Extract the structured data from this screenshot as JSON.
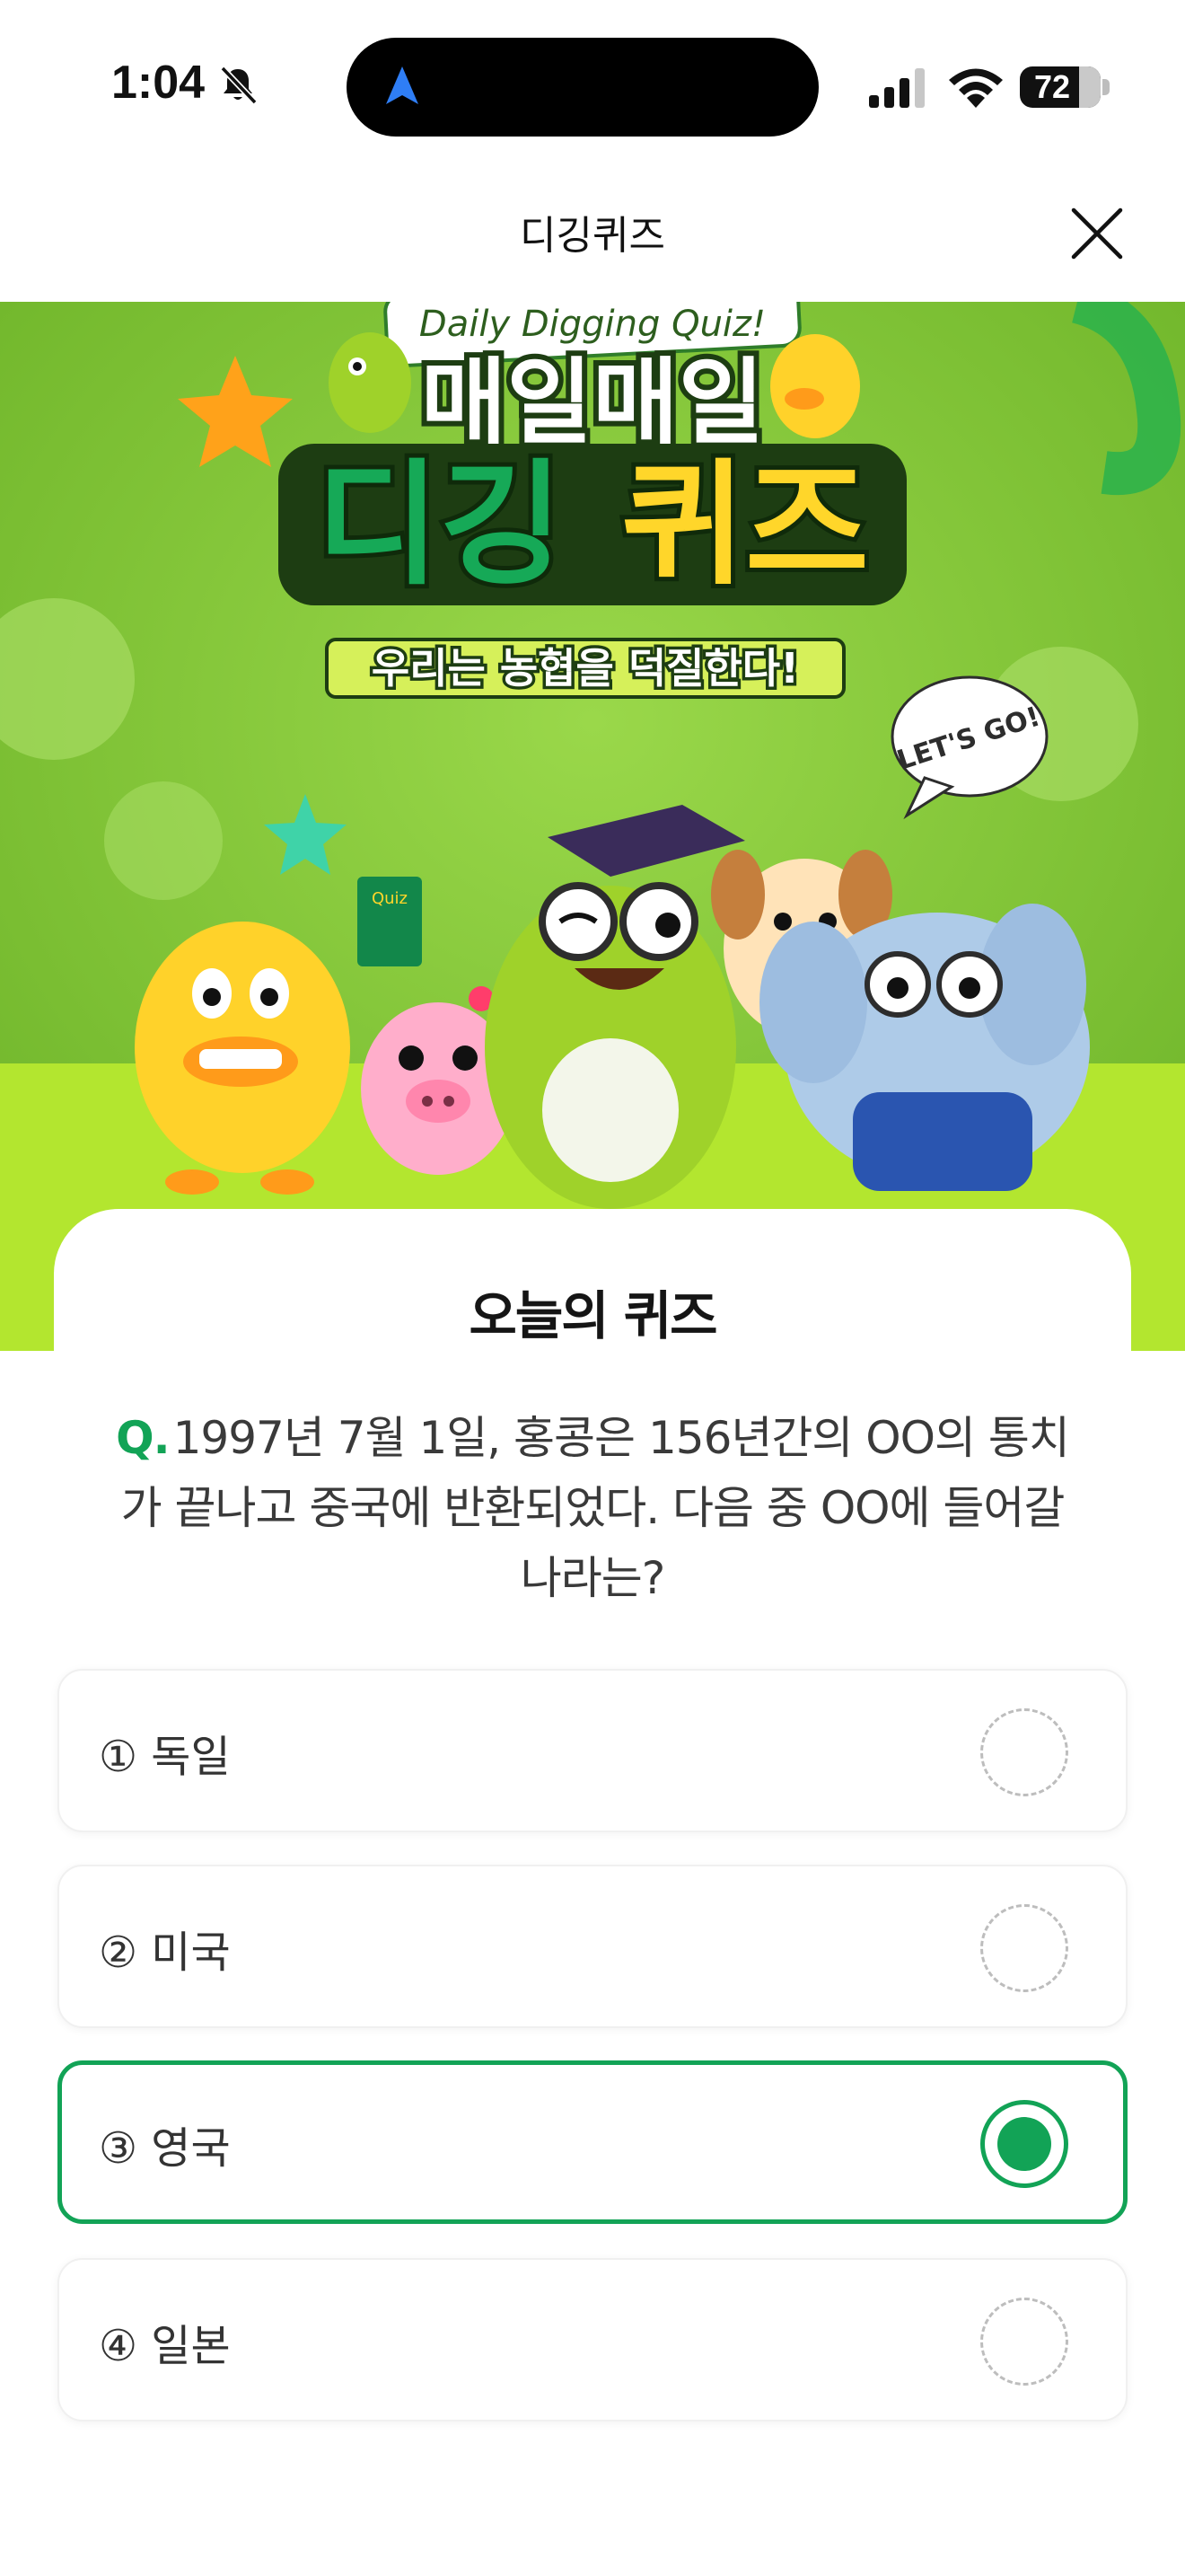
{
  "status_bar": {
    "time": "1:04",
    "battery": "72",
    "icons": [
      "bell-muted-icon",
      "navigation-arrow-icon",
      "cellular-signal-icon",
      "wifi-icon",
      "battery-icon"
    ]
  },
  "header": {
    "title": "디깅퀴즈",
    "close_icon": "close-icon"
  },
  "banner": {
    "ribbon": "Daily Digging Quiz!",
    "title_line1": "매일매일",
    "title_line2_a": "디깅",
    "title_line2_b": "퀴즈",
    "tagline": "우리는 농협을 덕질한다!",
    "bubble": "LET'S GO!",
    "book_label": "Quiz",
    "colors": {
      "background": "#8cce3a",
      "accent_green": "#12a356",
      "accent_yellow": "#ffd62a"
    }
  },
  "quiz": {
    "heading": "오늘의 퀴즈",
    "question_prefix": "Q.",
    "question": "1997년 7월 1일, 홍콩은 156년간의 OO의 통치가 끝나고 중국에 반환되었다. 다음 중 OO에 들어갈 나라는?",
    "options": [
      {
        "label": "① 독일",
        "selected": false
      },
      {
        "label": "② 미국",
        "selected": false
      },
      {
        "label": "③ 영국",
        "selected": true
      },
      {
        "label": "④ 일본",
        "selected": false
      }
    ],
    "selected_color": "#12a356"
  }
}
